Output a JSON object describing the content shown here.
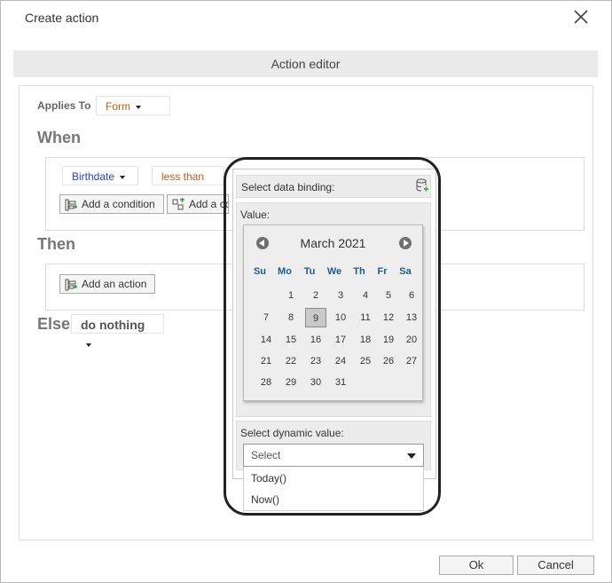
{
  "dialog": {
    "title": "Create action",
    "ok_label": "Ok",
    "cancel_label": "Cancel"
  },
  "editor": {
    "header": "Action editor"
  },
  "applies_to": {
    "label": "Applies To",
    "value": "Form"
  },
  "when": {
    "heading": "When",
    "field": "Birthdate",
    "operator": "less than",
    "add_condition_label": "Add a condition",
    "add_group_label": "Add a co"
  },
  "then": {
    "heading": "Then",
    "add_action_label": "Add an action"
  },
  "else": {
    "heading": "Else",
    "value": "do nothing"
  },
  "binding_popup": {
    "title": "Select data binding:",
    "value_label": "Value:",
    "dynamic_label": "Select dynamic value:",
    "select_placeholder": "Select",
    "options": [
      "Today()",
      "Now()"
    ]
  },
  "calendar": {
    "month_label": "March 2021",
    "weekdays": [
      "Su",
      "Mo",
      "Tu",
      "We",
      "Th",
      "Fr",
      "Sa"
    ],
    "weeks": [
      [
        "",
        "1",
        "2",
        "3",
        "4",
        "5",
        "6"
      ],
      [
        "7",
        "8",
        "9",
        "10",
        "11",
        "12",
        "13"
      ],
      [
        "14",
        "15",
        "16",
        "17",
        "18",
        "19",
        "20"
      ],
      [
        "21",
        "22",
        "23",
        "24",
        "25",
        "26",
        "27"
      ],
      [
        "28",
        "29",
        "30",
        "31",
        "",
        "",
        ""
      ]
    ],
    "selected_day": "9"
  },
  "colors": {
    "link_blue": "#2b46a8",
    "operator_orange": "#b85c1c",
    "weekday_blue": "#1e5a8c"
  }
}
